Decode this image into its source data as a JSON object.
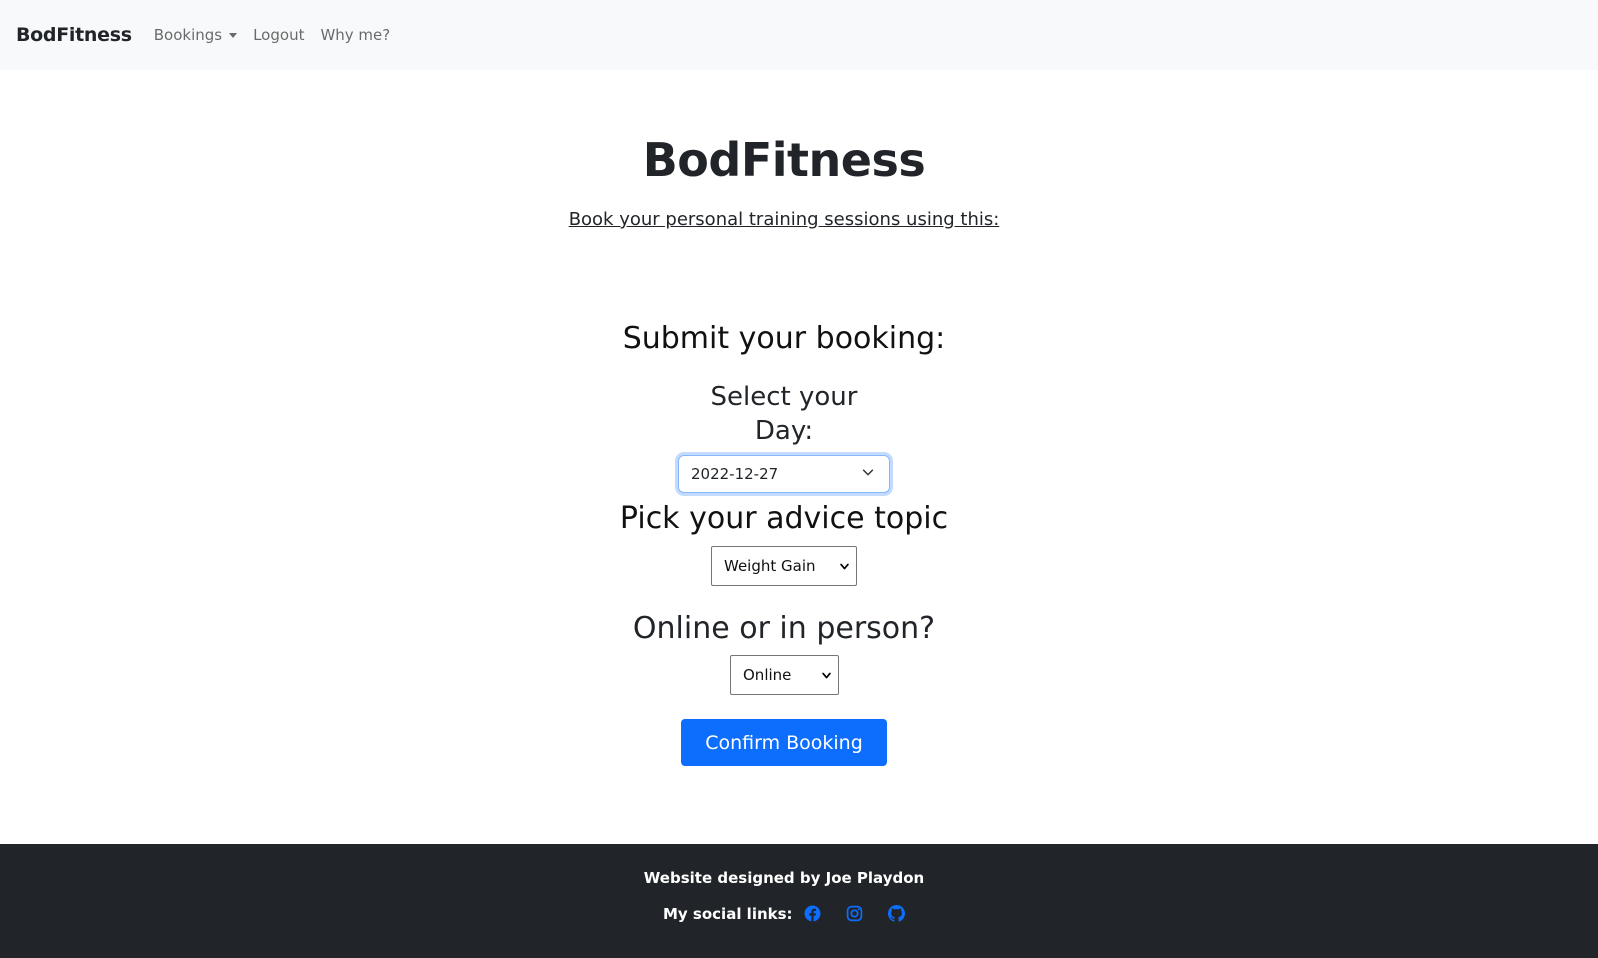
{
  "navbar": {
    "brand": "BodFitness",
    "links": {
      "bookings": "Bookings",
      "logout": "Logout",
      "why_me": "Why me?"
    }
  },
  "hero": {
    "title": "BodFitness",
    "subtitle": "Book your personal training sessions using this:"
  },
  "form": {
    "heading": "Submit your booking:",
    "day_label_line1": "Select your",
    "day_label_line2": "Day:",
    "day_value": "2022-12-27",
    "topic_heading": "Pick your advice topic",
    "topic_value": "Weight Gain",
    "mode_heading": "Online or in person?",
    "mode_value": "Online",
    "submit_label": "Confirm Booking"
  },
  "footer": {
    "credit": "Website designed by Joe Playdon",
    "social_label": "My social links:",
    "social_icons": [
      "facebook-icon",
      "instagram-icon",
      "github-icon"
    ]
  },
  "colors": {
    "primary": "#0d6efd",
    "navbar_bg": "#f8f9fa",
    "footer_bg": "#212529",
    "focus_border": "#86b7fe"
  }
}
